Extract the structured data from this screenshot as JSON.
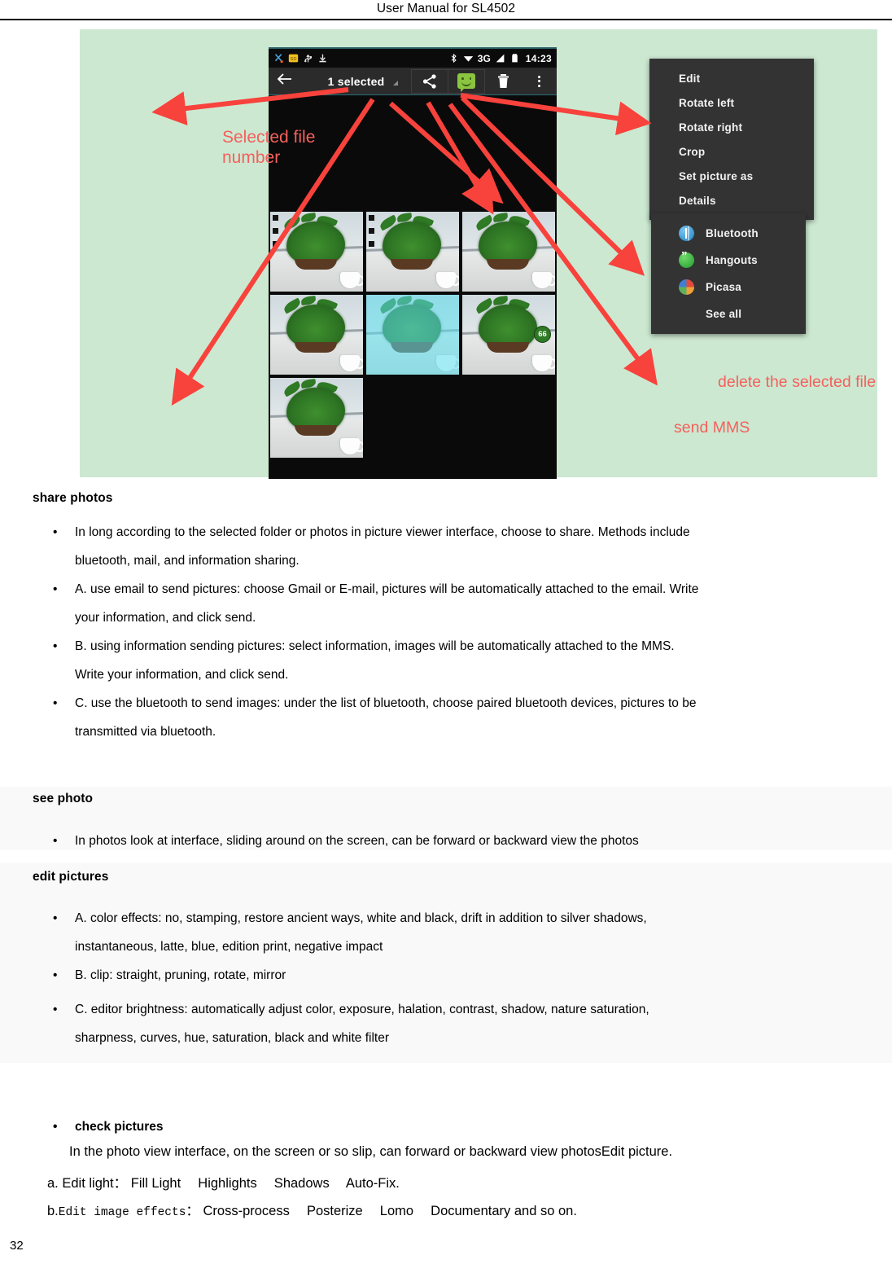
{
  "header": {
    "title": "User Manual for SL4502"
  },
  "figure": {
    "background_color": "#cce8d1",
    "phone": {
      "statusbar": {
        "icons_left": [
          "scissors-icon",
          "sd-card-icon",
          "usb-icon",
          "download-icon"
        ],
        "icons_right": [
          "bluetooth-icon",
          "wifi-icon",
          "signal-icon",
          "battery-icon"
        ],
        "network": "3G",
        "time": "14:23"
      },
      "actionbar": {
        "back_icon": "back-arrow-icon",
        "title": "1 selected",
        "share_icon": "share-icon",
        "mms_icon": "mms-icon",
        "delete_icon": "trash-icon",
        "overflow_icon": "overflow-menu-icon"
      },
      "grid": {
        "rows": [
          [
            "photo-1",
            "photo-2",
            "photo-3"
          ],
          [
            "photo-4",
            "photo-5-selected",
            "photo-6"
          ],
          [
            "photo-7"
          ]
        ],
        "selected_index": 4,
        "badge": "66"
      }
    },
    "overflow_menu": {
      "items": [
        "Edit",
        "Rotate left",
        "Rotate right",
        "Crop",
        "Set picture as",
        "Details"
      ]
    },
    "share_menu": {
      "items": [
        {
          "label": "Bluetooth",
          "icon": "bluetooth-app-icon"
        },
        {
          "label": "Hangouts",
          "icon": "hangouts-app-icon"
        },
        {
          "label": "Picasa",
          "icon": "picasa-app-icon"
        },
        {
          "label": "See all",
          "icon": ""
        }
      ]
    },
    "annotations": {
      "color": "#f4605c",
      "selected_file_number": "Selected file\nnumber",
      "delete_selected": "delete the selected file",
      "send_mms": "send MMS"
    }
  },
  "sections": [
    {
      "heading": "share photos",
      "bullets": [
        {
          "line1": "In long according to the selected folder or photos in picture viewer interface, choose to share. Methods include",
          "line2": "bluetooth, mail, and information sharing."
        },
        {
          "line1": "A. use email to send pictures: choose Gmail or E-mail, pictures will be automatically attached to the email. Write",
          "line2": "your information, and click send."
        },
        {
          "line1": "B. using information sending pictures: select information, images will be automatically attached to the MMS.",
          "line2": "Write your information, and click send."
        },
        {
          "line1": "C. use the bluetooth to send images: under the list of bluetooth, choose paired bluetooth devices, pictures to be",
          "line2": "transmitted via bluetooth."
        }
      ]
    },
    {
      "heading": "see photo",
      "bullets": [
        {
          "line1": "In photos look at interface, sliding around on the screen, can be forward or backward view the photos",
          "line2": ""
        }
      ]
    },
    {
      "heading": "edit pictures",
      "bullets": [
        {
          "line1": "A. color effects: no, stamping, restore ancient ways, white and black, drift in addition to silver shadows,",
          "line2": "instantaneous, latte, blue, edition print, negative impact"
        },
        {
          "line1": "B. clip: straight, pruning, rotate, mirror",
          "line2": ""
        },
        {
          "line1": "C. editor brightness: automatically adjust color, exposure, halation, contrast, shadow, nature saturation,",
          "line2": "sharpness, curves, hue, saturation, black and white filter"
        }
      ]
    }
  ],
  "check_section": {
    "bullet_heading": "check pictures",
    "intro": "In the photo view interface, on the screen or so slip, can forward or backward view photosEdit picture.",
    "items": [
      {
        "marker": "a.",
        "label": "Edit light：",
        "label_mono": false,
        "values": "Fill Light　 Highlights　 Shadows　 Auto-Fix."
      },
      {
        "marker": "b.",
        "label": "Edit image effects",
        "label_mono": true,
        "separator": "：",
        "values": "Cross-process　 Posterize　 Lomo　 Documentary and so on."
      }
    ]
  },
  "footer": {
    "page_number": "32"
  }
}
